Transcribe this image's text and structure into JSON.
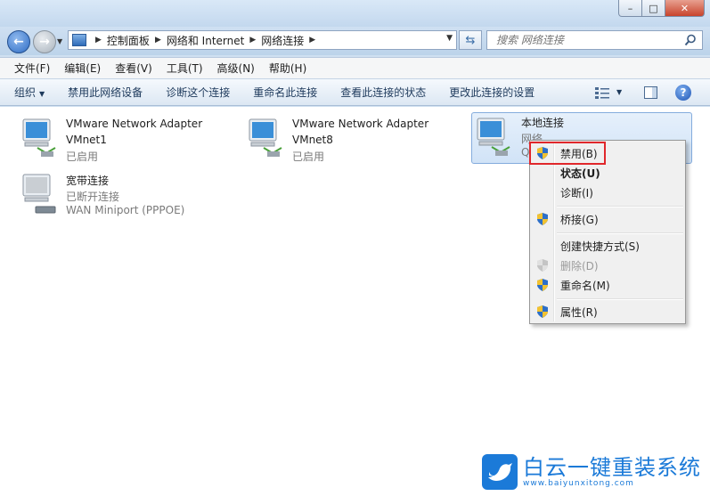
{
  "address": {
    "crumbs": [
      "控制面板",
      "网络和 Internet",
      "网络连接"
    ]
  },
  "search": {
    "placeholder": "搜索 网络连接"
  },
  "menubar": {
    "items": [
      "文件(F)",
      "编辑(E)",
      "查看(V)",
      "工具(T)",
      "高级(N)",
      "帮助(H)"
    ]
  },
  "cmdbar": {
    "organize": "组织",
    "items": [
      "禁用此网络设备",
      "诊断这个连接",
      "重命名此连接",
      "查看此连接的状态",
      "更改此连接的设置"
    ]
  },
  "connections": [
    {
      "name": "VMware Network Adapter",
      "line2": "VMnet1",
      "line3": "已启用"
    },
    {
      "name": "VMware Network Adapter",
      "line2": "VMnet8",
      "line3": "已启用"
    },
    {
      "name": "本地连接",
      "line2": "网络",
      "line3": "Q"
    },
    {
      "name": "宽带连接",
      "line2": "已断开连接",
      "line3": "WAN Miniport (PPPOE)"
    }
  ],
  "context_menu": {
    "items": [
      {
        "label": "禁用(B)"
      },
      {
        "label": "状态(U)"
      },
      {
        "label": "诊断(I)"
      },
      {
        "label": "桥接(G)"
      },
      {
        "label": "创建快捷方式(S)"
      },
      {
        "label": "删除(D)"
      },
      {
        "label": "重命名(M)"
      },
      {
        "label": "属性(R)"
      }
    ]
  },
  "watermark": {
    "title": "白云一键重装系统",
    "url": "www.baiyunxitong.com"
  },
  "colors": {
    "accent": "#1b7ad8",
    "highlight_border": "#e0272b",
    "selection": "#d1e3f7"
  },
  "icons": [
    "back-arrow-icon",
    "forward-arrow-icon",
    "control-panel-icon",
    "refresh-icon",
    "search-icon",
    "network-adapter-icon",
    "shield-icon",
    "help-icon"
  ]
}
